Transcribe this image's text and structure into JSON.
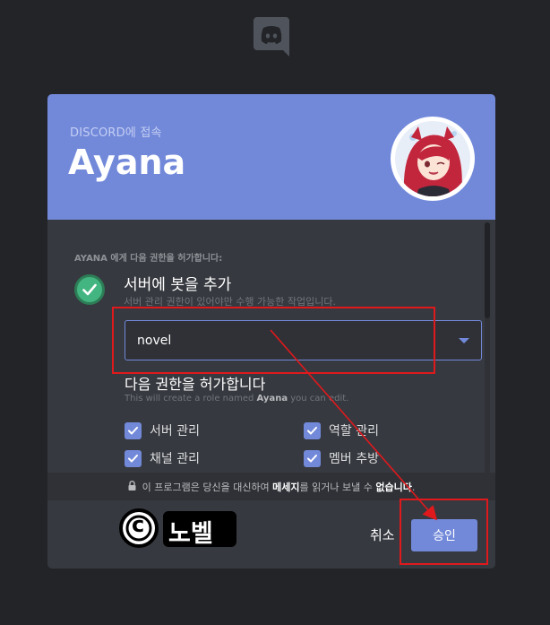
{
  "header": {
    "subtitle": "DISCORD에 접속",
    "bot_name": "Ayana"
  },
  "permissions": {
    "heading": "AYANA 에게 다음 권한을 허가합니다:",
    "item_title": "서버에 봇을 추가",
    "item_desc": "서버 관리 권한이 있어야만 수행 가능한 작업입니다.",
    "server_select": {
      "value": "novel"
    },
    "grant_title": "다음 권한을 허가합니다",
    "grant_note_before": "This will create a role named ",
    "grant_note_name": "Ayana",
    "grant_note_after": " you can edit.",
    "checkboxes": [
      {
        "label": "서버 관리",
        "checked": true
      },
      {
        "label": "역할 관리",
        "checked": true
      },
      {
        "label": "채널 관리",
        "checked": true
      },
      {
        "label": "멤버 추방",
        "checked": true
      }
    ]
  },
  "notice": {
    "before": "이 프로그램은 당신을 대신하여 ",
    "bold1": "메세지",
    "middle": "를 읽거나 보낼 수 ",
    "bold2": "없습니다",
    "after": "."
  },
  "footer": {
    "cancel_label": "취소",
    "authorize_label": "승인"
  },
  "watermark": {
    "symbol": "c",
    "text": "노벨"
  },
  "colors": {
    "blurple": "#7289da",
    "green": "#43b581",
    "background": "#232428",
    "modal": "#36393f",
    "annotation_red": "#e0191d"
  },
  "icons": {
    "logo": "discord-logo-icon",
    "check": "check-circle-icon",
    "lock": "lock-icon",
    "dropdown": "chevron-down-icon"
  }
}
